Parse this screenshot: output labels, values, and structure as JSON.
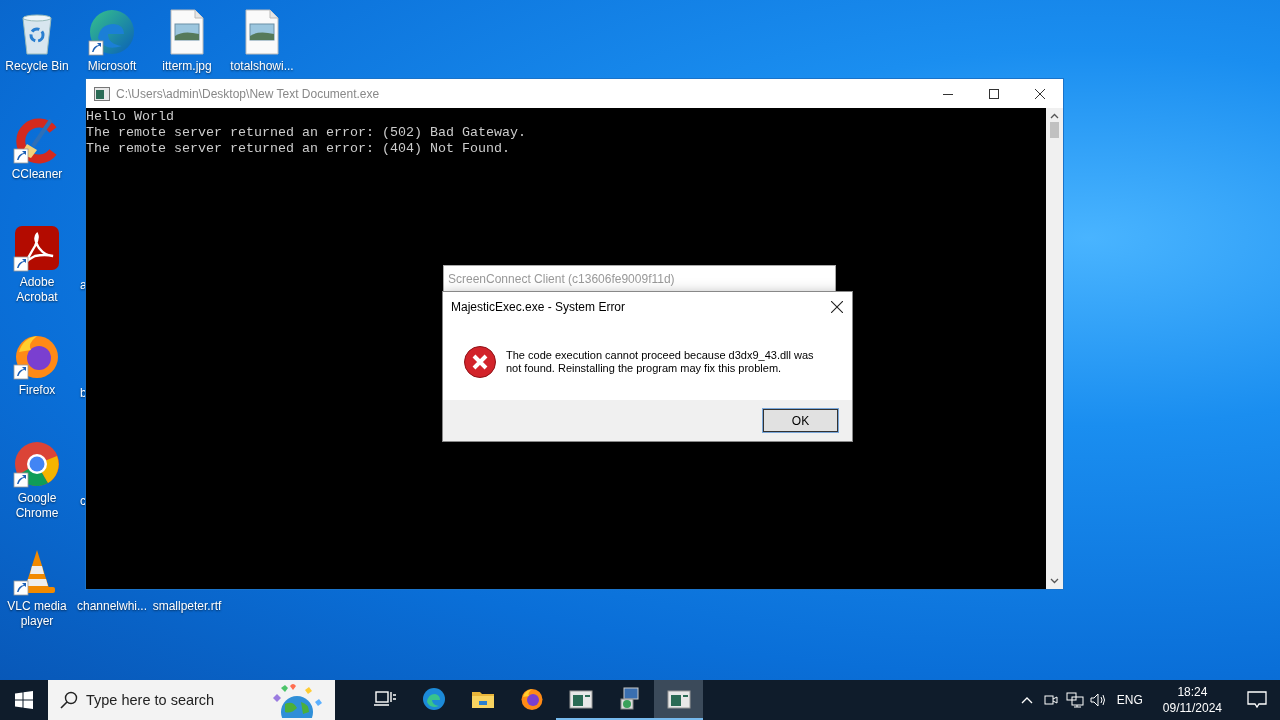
{
  "desktop": {
    "icons": [
      {
        "label": "Recycle Bin",
        "kind": "recycle",
        "shortcut": false
      },
      {
        "label": "Microsoft",
        "kind": "edge",
        "shortcut": true
      },
      {
        "label": "itterm.jpg",
        "kind": "image",
        "shortcut": false
      },
      {
        "label": "totalshowi...",
        "kind": "image",
        "shortcut": false
      },
      {
        "label": "CCleaner",
        "kind": "ccleaner",
        "shortcut": true
      },
      {
        "label": "Adobe Acrobat",
        "kind": "acrobat",
        "shortcut": true
      },
      {
        "label": "a",
        "kind": "cut"
      },
      {
        "label": "Firefox",
        "kind": "firefox",
        "shortcut": true
      },
      {
        "label": "b",
        "kind": "cut"
      },
      {
        "label": "Google Chrome",
        "kind": "chrome",
        "shortcut": true
      },
      {
        "label": "c",
        "kind": "cut"
      },
      {
        "label": "VLC media player",
        "kind": "vlc",
        "shortcut": true
      },
      {
        "label": "channelwhi...",
        "kind": "hidden"
      },
      {
        "label": "smallpeter.rtf",
        "kind": "hidden"
      }
    ]
  },
  "console_window": {
    "title": "C:\\Users\\admin\\Desktop\\New Text Document.exe",
    "lines": [
      "Hello World",
      "The remote server returned an error: (502) Bad Gateway.",
      "The remote server returned an error: (404) Not Found."
    ]
  },
  "background_window": {
    "title": "ScreenConnect Client (c13606fe9009f11d)"
  },
  "error_dialog": {
    "title": "MajesticExec.exe - System Error",
    "message": "The code execution cannot proceed because d3dx9_43.dll was not found. Reinstalling the program may fix this problem.",
    "button": "OK"
  },
  "taskbar": {
    "search_placeholder": "Type here to search",
    "apps": [
      {
        "kind": "taskview",
        "running": false,
        "selected": false
      },
      {
        "kind": "edge",
        "running": false,
        "selected": false
      },
      {
        "kind": "explorer",
        "running": false,
        "selected": false
      },
      {
        "kind": "firefox",
        "running": false,
        "selected": false
      },
      {
        "kind": "console",
        "running": true,
        "selected": false
      },
      {
        "kind": "installer",
        "running": true,
        "selected": false
      },
      {
        "kind": "console",
        "running": true,
        "selected": true
      }
    ],
    "language": "ENG",
    "time": "18:24",
    "date": "09/11/2024"
  }
}
